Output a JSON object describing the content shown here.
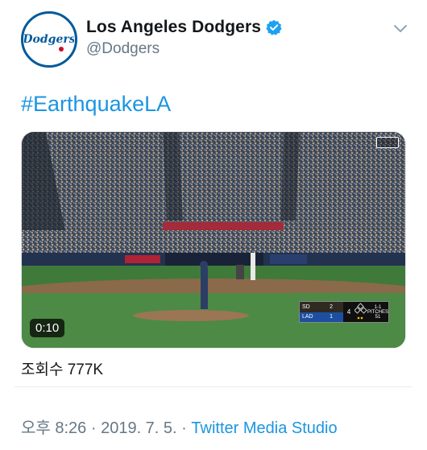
{
  "colors": {
    "link_blue": "#1b95e0",
    "secondary_text": "#657786",
    "verified_blue": "#1da1f2",
    "dodgers_blue": "#005a9c"
  },
  "account": {
    "display_name": "Los Angeles Dodgers",
    "handle": "@Dodgers",
    "verified": true,
    "avatar_text": "Dodgers"
  },
  "tweet": {
    "hashtag": "#EarthquakeLA"
  },
  "video": {
    "duration": "0:10",
    "scorebug": {
      "away_abbr": "SD",
      "away_score": "2",
      "home_abbr": "LAD",
      "home_score": "1",
      "inning": "4",
      "count": "1-1",
      "pitches_label": "PITCHES",
      "pitches": "51"
    }
  },
  "stats": {
    "views_label": "조회수",
    "views_value": "777K"
  },
  "meta": {
    "time": "오후 8:26",
    "separator": " · ",
    "date": "2019. 7. 5.",
    "source": "Twitter Media Studio"
  }
}
